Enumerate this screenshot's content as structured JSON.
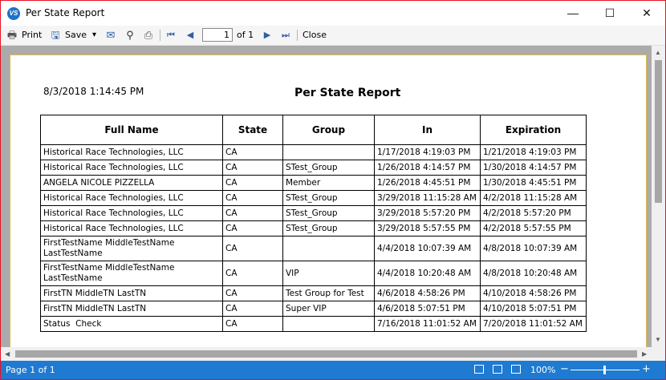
{
  "window": {
    "app_icon_text": "VS",
    "title": "Per State Report",
    "controls": {
      "minimize": "—",
      "maximize": "☐",
      "close": "✕"
    }
  },
  "toolbar": {
    "print_label": "Print",
    "save_label": "Save",
    "page_value": "1",
    "page_of": "of 1",
    "close_label": "Close",
    "icons": {
      "print": "🖶",
      "save": "🖫",
      "dropdown": "▾",
      "email": "✉",
      "find": "⚲",
      "export": "⎙",
      "first": "⏮",
      "prev": "◀",
      "next": "▶",
      "last": "⏭"
    }
  },
  "report": {
    "date": "8/3/2018 1:14:45 PM",
    "title": "Per State Report",
    "columns": [
      "Full Name",
      "State",
      "Group",
      "In",
      "Expiration"
    ],
    "rows": [
      [
        "Historical Race Technologies, LLC",
        "CA",
        "",
        "1/17/2018 4:19:03 PM",
        "1/21/2018 4:19:03 PM"
      ],
      [
        "Historical Race Technologies, LLC",
        "CA",
        "STest_Group",
        "1/26/2018 4:14:57 PM",
        "1/30/2018 4:14:57 PM"
      ],
      [
        "ANGELA NICOLE PIZZELLA",
        "CA",
        "Member",
        "1/26/2018 4:45:51 PM",
        "1/30/2018 4:45:51 PM"
      ],
      [
        "Historical Race Technologies, LLC",
        "CA",
        "STest_Group",
        "3/29/2018 11:15:28 AM",
        "4/2/2018 11:15:28 AM"
      ],
      [
        "Historical Race Technologies, LLC",
        "CA",
        "STest_Group",
        "3/29/2018 5:57:20 PM",
        "4/2/2018 5:57:20 PM"
      ],
      [
        "Historical Race Technologies, LLC",
        "CA",
        "STest_Group",
        "3/29/2018 5:57:55 PM",
        "4/2/2018 5:57:55 PM"
      ],
      [
        "FirstTestName MiddleTestName LastTestName",
        "CA",
        "",
        "4/4/2018 10:07:39 AM",
        "4/8/2018 10:07:39 AM"
      ],
      [
        "FirstTestName MiddleTestName LastTestName",
        "CA",
        "VIP",
        "4/4/2018 10:20:48 AM",
        "4/8/2018 10:20:48 AM"
      ],
      [
        "FirstTN MiddleTN LastTN",
        "CA",
        "Test Group for Test",
        "4/6/2018 4:58:26 PM",
        "4/10/2018 4:58:26 PM"
      ],
      [
        "FirstTN MiddleTN LastTN",
        "CA",
        "Super VIP",
        "4/6/2018 5:07:51 PM",
        "4/10/2018 5:07:51 PM"
      ],
      [
        "Status  Check",
        "CA",
        "",
        "7/16/2018 11:01:52 AM",
        "7/20/2018 11:01:52 AM"
      ]
    ]
  },
  "statusbar": {
    "page_status": "Page 1 of 1",
    "zoom": "100%",
    "zoom_out": "−",
    "zoom_in": "+"
  },
  "colors": {
    "accent": "#1f7ad1",
    "window_border": "#e81123",
    "paper_border": "#e0b84a"
  }
}
